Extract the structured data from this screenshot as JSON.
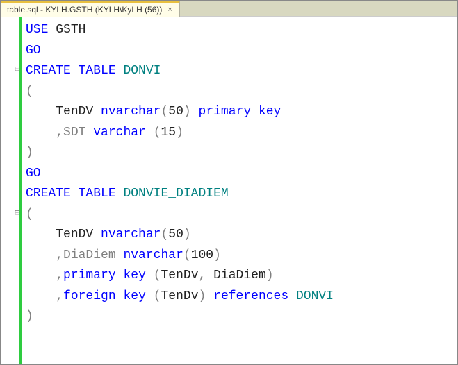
{
  "tab": {
    "title": "table.sql - KYLH.GSTH (KYLH\\KyLH (56))",
    "close_symbol": "×"
  },
  "code": {
    "use": "USE",
    "db": "GSTH",
    "go1": "GO",
    "create1": "CREATE",
    "table1": "TABLE",
    "donvi": "DONVI",
    "lparen1": "(",
    "tendv1": "TenDV",
    "nvarchar1": "nvarchar",
    "lp1": "(",
    "fifty1": "50",
    "rp1": ")",
    "primary1": "primary",
    "key1": "key",
    "comma_sdt": ",SDT",
    "varchar1": "varchar",
    "lp2": "(",
    "fifteen": "15",
    "rp2": ")",
    "rparen1": ")",
    "go2": "GO",
    "create2": "CREATE",
    "table2": "TABLE",
    "donvie": "DONVIE_DIADIEM",
    "lparen2": "(",
    "tendv2": "TenDV",
    "nvarchar2": "nvarchar",
    "lp3": "(",
    "fifty2": "50",
    "rp3": ")",
    "comma_diadiem": ",DiaDiem",
    "nvarchar3": "nvarchar",
    "lp4": "(",
    "hundred": "100",
    "rp4": ")",
    "comma3": ",",
    "primary2": "primary",
    "key2": "key",
    "lp5": "(",
    "tendv_pk": "TenDv",
    "comma_pk": ",",
    "diadiem_pk": "DiaDiem",
    "rp5": ")",
    "comma4": ",",
    "foreign1": "foreign",
    "key3": "key",
    "lp6": "(",
    "tendv_fk": "TenDv",
    "rp6": ")",
    "references1": "references",
    "donvi_ref": "DONVI",
    "rparen2": ")"
  }
}
